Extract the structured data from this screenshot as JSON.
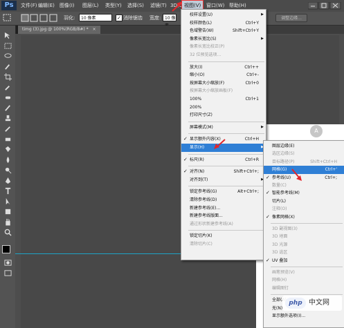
{
  "menubar": {
    "logo": "Ps",
    "items": [
      "文件(F)",
      "编辑(E)",
      "图像(I)",
      "图层(L)",
      "类型(Y)",
      "选择(S)",
      "滤镜(T)",
      "3D(D)",
      "视图(V)",
      "窗口(W)",
      "帮助(H)"
    ],
    "active_index": 8
  },
  "options": {
    "feather_label": "羽化:",
    "feather_value": "10 像素",
    "antialias_label": "消除锯齿",
    "antialias_checked": true,
    "width_label": "宽度:",
    "width_value": "10 像素",
    "refine_edge_label": "调整边缘..."
  },
  "document": {
    "tab_title": "timg (3).jpg @ 100%(RGB/8#) *",
    "close_label": "×"
  },
  "view_menu": {
    "items": [
      {
        "label": "校样设置(U)",
        "arrow": true
      },
      {
        "label": "校样颜色(L)",
        "shortcut": "Ctrl+Y"
      },
      {
        "label": "色域警告(W)",
        "shortcut": "Shift+Ctrl+Y"
      },
      {
        "label": "像素长宽比(S)",
        "arrow": true
      },
      {
        "label": "像素长宽比校正(P)",
        "disabled": true
      },
      {
        "label": "32 位预览选项...",
        "disabled": true
      },
      {
        "sep": true
      },
      {
        "label": "放大(I)",
        "shortcut": "Ctrl++"
      },
      {
        "label": "缩小(O)",
        "shortcut": "Ctrl+-"
      },
      {
        "label": "按屏幕大小缩放(F)",
        "shortcut": "Ctrl+0"
      },
      {
        "label": "按屏幕大小缩放画板(F)",
        "disabled": true
      },
      {
        "label": "100%",
        "shortcut": "Ctrl+1"
      },
      {
        "label": "200%"
      },
      {
        "label": "打印尺寸(Z)"
      },
      {
        "sep": true
      },
      {
        "label": "屏幕模式(M)",
        "arrow": true
      },
      {
        "sep": true
      },
      {
        "label": "显示额外内容(X)",
        "shortcut": "Ctrl+H",
        "check": true
      },
      {
        "label": "显示(H)",
        "arrow": true,
        "highlight": true
      },
      {
        "sep": true
      },
      {
        "label": "标尺(R)",
        "shortcut": "Ctrl+R",
        "check": true
      },
      {
        "sep": true
      },
      {
        "label": "对齐(N)",
        "shortcut": "Shift+Ctrl+;",
        "check": true
      },
      {
        "label": "对齐到(T)",
        "arrow": true
      },
      {
        "sep": true
      },
      {
        "label": "锁定参考线(G)",
        "shortcut": "Alt+Ctrl+;"
      },
      {
        "label": "清除参考线(D)"
      },
      {
        "label": "新建参考线(E)..."
      },
      {
        "label": "新建参考线版面..."
      },
      {
        "label": "通过形状新建参考线(A)",
        "disabled": true
      },
      {
        "sep": true
      },
      {
        "label": "锁定切片(K)"
      },
      {
        "label": "清除切片(C)",
        "disabled": true
      }
    ]
  },
  "show_submenu": {
    "items": [
      {
        "label": "图层边缘(E)"
      },
      {
        "label": "选区边缘(S)",
        "disabled": true
      },
      {
        "label": "目标路径(P)",
        "shortcut": "Shift+Ctrl+H",
        "disabled": true
      },
      {
        "label": "网格(G)",
        "shortcut": "Ctrl+'",
        "highlight": true
      },
      {
        "label": "参考线(U)",
        "shortcut": "Ctrl+;",
        "check": true
      },
      {
        "label": "数量(C)",
        "disabled": true
      },
      {
        "label": "智能参考线(M)",
        "check": true
      },
      {
        "label": "切片(L)"
      },
      {
        "label": "注释(O)",
        "disabled": true
      },
      {
        "label": "像素网格(X)",
        "check": true
      },
      {
        "sep": true
      },
      {
        "label": "3D 副视图(3)",
        "disabled": true
      },
      {
        "label": "3D 地面",
        "disabled": true
      },
      {
        "label": "3D 光源",
        "disabled": true
      },
      {
        "label": "3D 选区",
        "disabled": true
      },
      {
        "label": "UV 叠加",
        "check": true
      },
      {
        "sep": true
      },
      {
        "label": "画笔预览(V)",
        "disabled": true
      },
      {
        "label": "网格(H)",
        "disabled": true
      },
      {
        "label": "编辑图钉",
        "disabled": true
      },
      {
        "sep": true
      },
      {
        "label": "全部(A)"
      },
      {
        "label": "无(N)"
      },
      {
        "label": "显示额外选项(I)..."
      }
    ]
  },
  "watermark": {
    "logo": "php",
    "text": "中文网"
  },
  "colors": {
    "highlight": "#2f7fd5",
    "arrow_red": "#e3262b",
    "guide": "#1ea4c8"
  }
}
